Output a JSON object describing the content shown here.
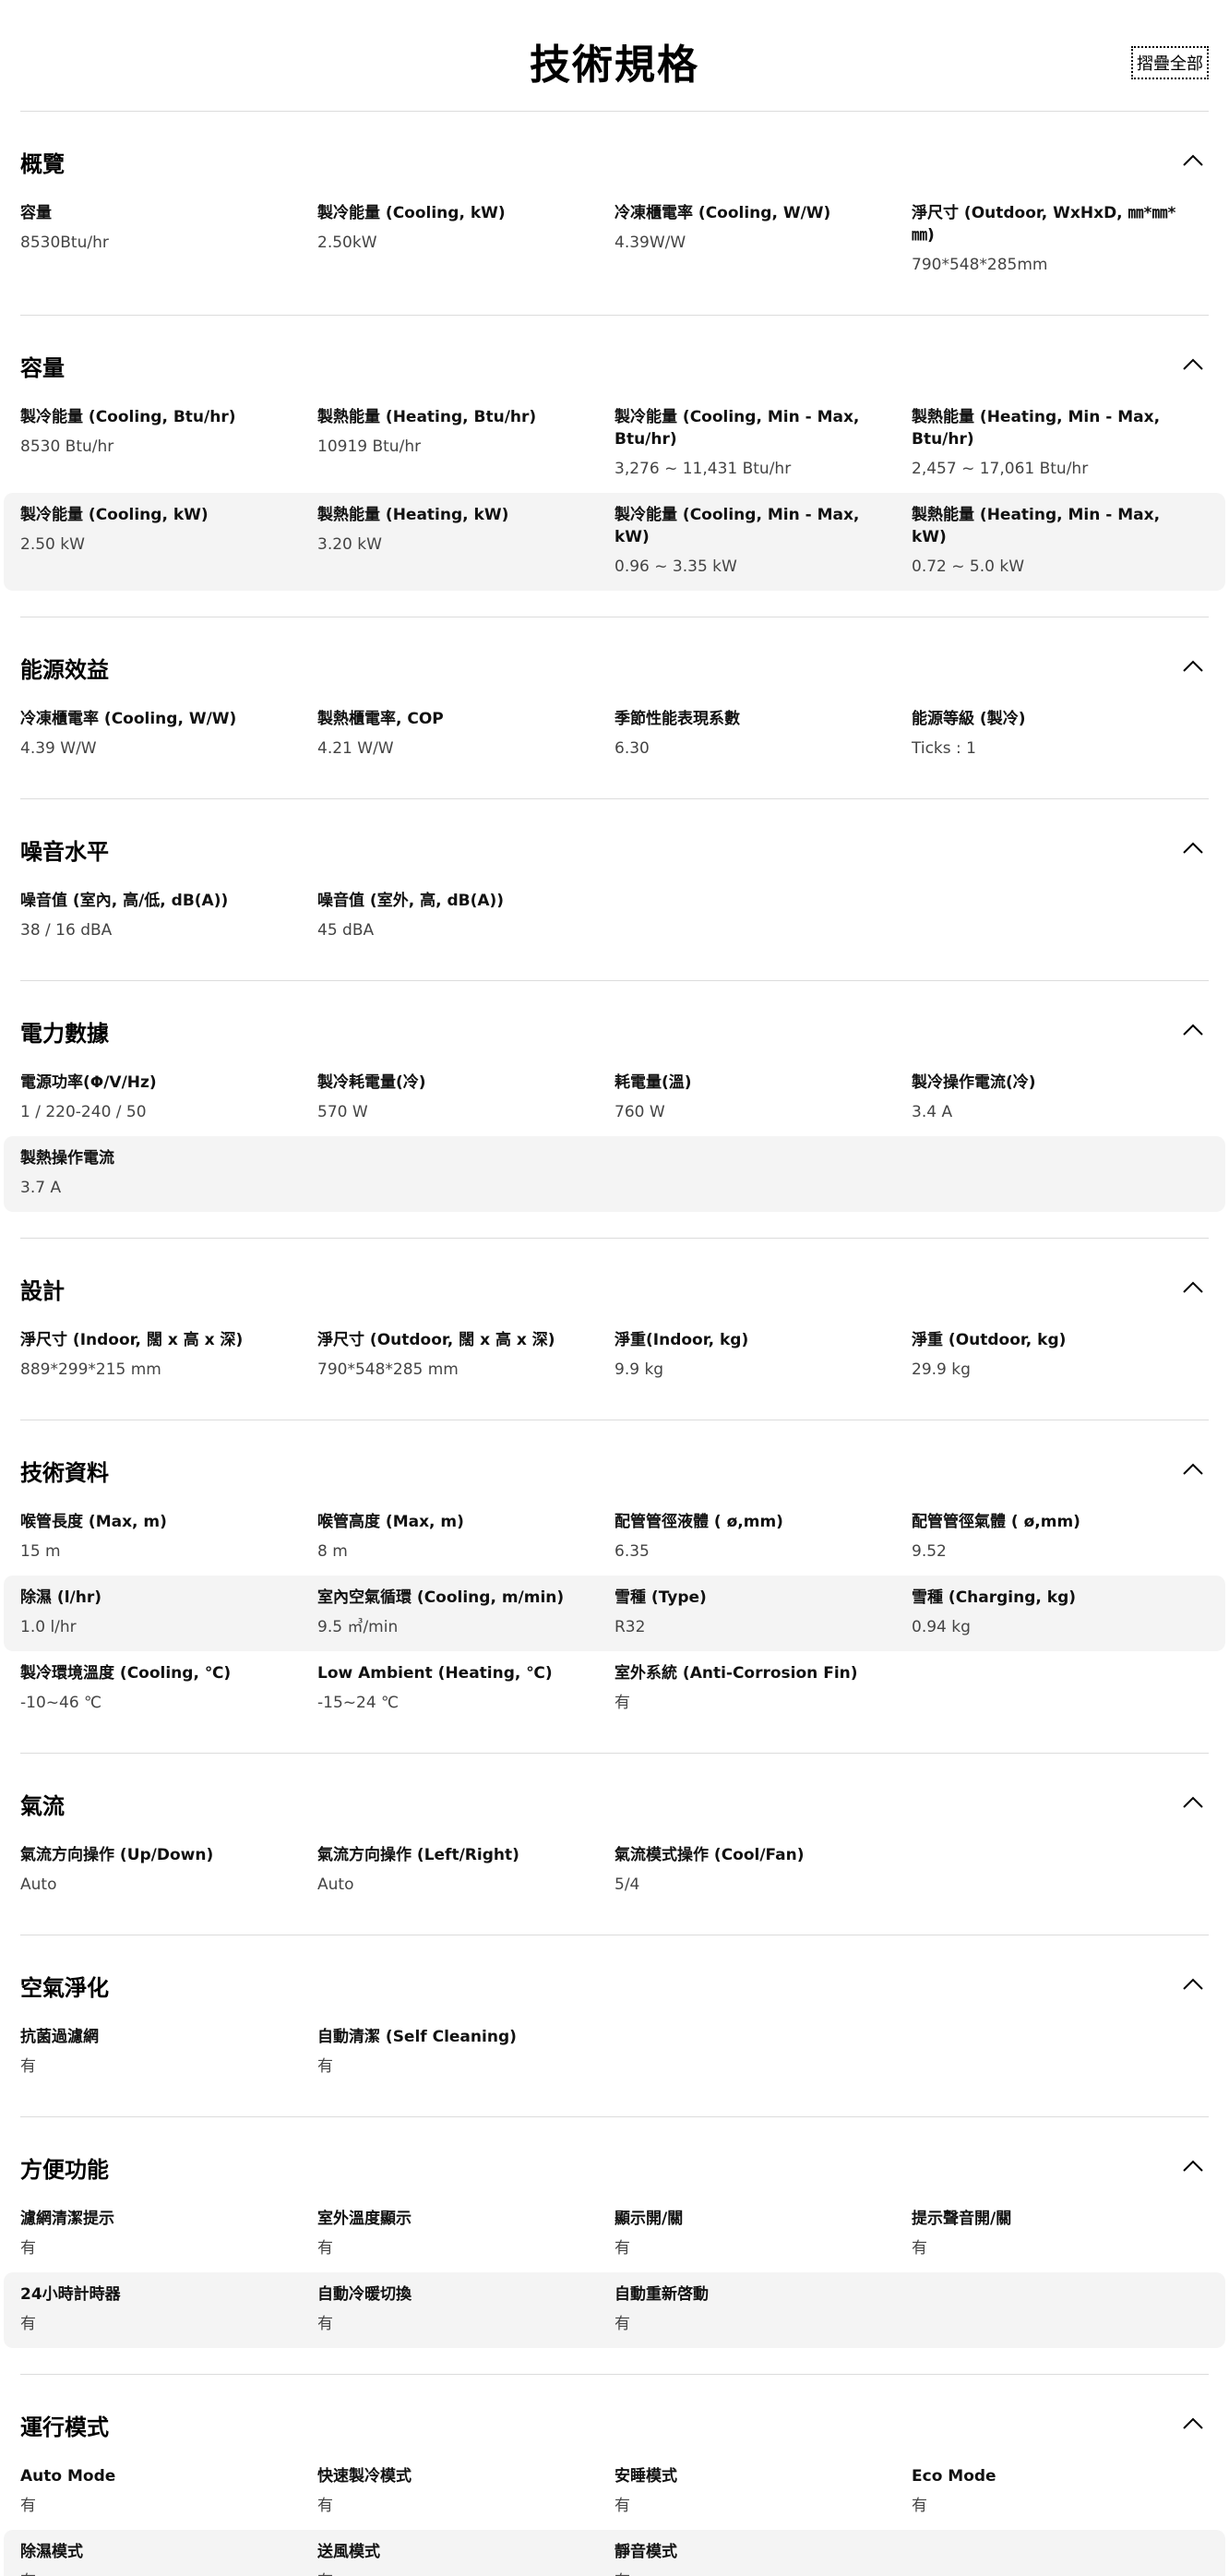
{
  "page": {
    "title": "技術規格",
    "collapse_all_label": "摺疊全部"
  },
  "icons": {
    "section_toggle": "chevron-up-icon"
  },
  "sections": [
    {
      "title": "概覽",
      "rows": [
        [
          {
            "label": "容量",
            "value": "8530Btu/hr"
          },
          {
            "label": "製冷能量 (Cooling, kW)",
            "value": "2.50kW"
          },
          {
            "label": "冷凍櫃電率 (Cooling, W/W)",
            "value": "4.39W/W"
          },
          {
            "label": "淨尺寸 (Outdoor, WxHxD, ㎜*㎜*㎜)",
            "value": "790*548*285mm"
          }
        ]
      ]
    },
    {
      "title": "容量",
      "rows": [
        [
          {
            "label": "製冷能量 (Cooling, Btu/hr)",
            "value": "8530 Btu/hr"
          },
          {
            "label": "製熱能量 (Heating, Btu/hr)",
            "value": "10919 Btu/hr"
          },
          {
            "label": "製冷能量 (Cooling, Min - Max, Btu/hr)",
            "value": "3,276 ~ 11,431 Btu/hr"
          },
          {
            "label": "製熱能量 (Heating, Min - Max, Btu/hr)",
            "value": "2,457 ~ 17,061 Btu/hr"
          }
        ],
        [
          {
            "label": "製冷能量 (Cooling, kW)",
            "value": "2.50 kW"
          },
          {
            "label": "製熱能量 (Heating, kW)",
            "value": "3.20 kW"
          },
          {
            "label": "製冷能量 (Cooling, Min - Max, kW)",
            "value": "0.96 ~ 3.35 kW"
          },
          {
            "label": "製熱能量 (Heating, Min - Max, kW)",
            "value": "0.72 ~ 5.0 kW"
          }
        ]
      ]
    },
    {
      "title": "能源效益",
      "rows": [
        [
          {
            "label": "冷凍櫃電率 (Cooling, W/W)",
            "value": "4.39 W/W"
          },
          {
            "label": "製熱櫃電率, COP",
            "value": "4.21 W/W"
          },
          {
            "label": "季節性能表現系數",
            "value": "6.30"
          },
          {
            "label": "能源等級 (製冷)",
            "value": "Ticks : 1"
          }
        ]
      ]
    },
    {
      "title": "噪音水平",
      "rows": [
        [
          {
            "label": "噪音值 (室內, 高/低, dB(A))",
            "value": "38 / 16 dBA"
          },
          {
            "label": "噪音值 (室外, 高, dB(A))",
            "value": "45 dBA"
          }
        ]
      ]
    },
    {
      "title": "電力數據",
      "rows": [
        [
          {
            "label": "電源功率(Φ/V/Hz)",
            "value": "1 / 220-240 / 50"
          },
          {
            "label": "製冷耗電量(冷)",
            "value": "570 W"
          },
          {
            "label": "耗電量(溫)",
            "value": "760 W"
          },
          {
            "label": "製冷操作電流(冷)",
            "value": "3.4 A"
          }
        ],
        [
          {
            "label": "製熱操作電流",
            "value": "3.7 A"
          }
        ]
      ]
    },
    {
      "title": "設計",
      "rows": [
        [
          {
            "label": "淨尺寸 (Indoor, 闊 x 高 x 深)",
            "value": "889*299*215 mm"
          },
          {
            "label": "淨尺寸 (Outdoor, 闊 x 高 x 深)",
            "value": "790*548*285 mm"
          },
          {
            "label": "淨重(Indoor, kg)",
            "value": "9.9 kg"
          },
          {
            "label": "淨重 (Outdoor, kg)",
            "value": "29.9 kg"
          }
        ]
      ]
    },
    {
      "title": "技術資料",
      "rows": [
        [
          {
            "label": "喉管長度 (Max, m)",
            "value": "15 m"
          },
          {
            "label": "喉管高度 (Max, m)",
            "value": "8 m"
          },
          {
            "label": "配管管徑液體 ( ø,mm)",
            "value": "6.35"
          },
          {
            "label": "配管管徑氣體 ( ø,mm)",
            "value": "9.52"
          }
        ],
        [
          {
            "label": "除濕 (l/hr)",
            "value": "1.0 l/hr"
          },
          {
            "label": "室內空氣循環 (Cooling, m/min)",
            "value": "9.5 ㎥/min"
          },
          {
            "label": "雪種 (Type)",
            "value": "R32"
          },
          {
            "label": "雪種 (Charging, kg)",
            "value": "0.94 kg"
          }
        ],
        [
          {
            "label": "製冷環境溫度 (Cooling, ℃)",
            "value": "-10~46 ℃"
          },
          {
            "label": "Low Ambient (Heating, ℃)",
            "value": "-15~24 ℃"
          },
          {
            "label": "室外系統 (Anti-Corrosion Fin)",
            "value": "有"
          }
        ]
      ]
    },
    {
      "title": "氣流",
      "rows": [
        [
          {
            "label": "氣流方向操作 (Up/Down)",
            "value": "Auto"
          },
          {
            "label": "氣流方向操作 (Left/Right)",
            "value": "Auto"
          },
          {
            "label": "氣流模式操作 (Cool/Fan)",
            "value": "5/4"
          }
        ]
      ]
    },
    {
      "title": "空氣淨化",
      "rows": [
        [
          {
            "label": "抗菌過濾網",
            "value": "有"
          },
          {
            "label": "自動清潔 (Self Cleaning)",
            "value": "有"
          }
        ]
      ]
    },
    {
      "title": "方便功能",
      "rows": [
        [
          {
            "label": "濾網清潔提示",
            "value": "有"
          },
          {
            "label": "室外溫度顯示",
            "value": "有"
          },
          {
            "label": "顯示開/關",
            "value": "有"
          },
          {
            "label": "提示聲音開/關",
            "value": "有"
          }
        ],
        [
          {
            "label": "24小時計時器",
            "value": "有"
          },
          {
            "label": "自動冷暖切換",
            "value": "有"
          },
          {
            "label": "自動重新啓動",
            "value": "有"
          }
        ]
      ]
    },
    {
      "title": "運行模式",
      "rows": [
        [
          {
            "label": "Auto Mode",
            "value": "有"
          },
          {
            "label": "快速製冷模式",
            "value": "有"
          },
          {
            "label": "安睡模式",
            "value": "有"
          },
          {
            "label": "Eco Mode",
            "value": "有"
          }
        ],
        [
          {
            "label": "除濕模式",
            "value": "有"
          },
          {
            "label": "送風模式",
            "value": "有"
          },
          {
            "label": "靜音模式",
            "value": "有"
          }
        ]
      ]
    }
  ]
}
